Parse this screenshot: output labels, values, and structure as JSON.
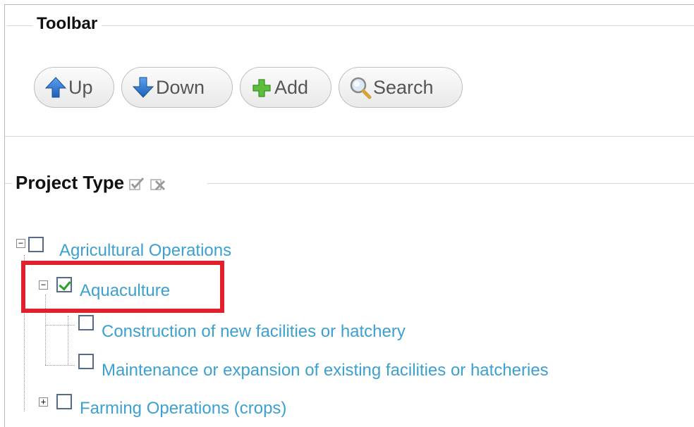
{
  "toolbar": {
    "title": "Toolbar",
    "buttons": [
      {
        "label": "Up",
        "icon": "arrow-up-icon"
      },
      {
        "label": "Down",
        "icon": "arrow-down-icon"
      },
      {
        "label": "Add",
        "icon": "plus-icon"
      },
      {
        "label": "Search",
        "icon": "magnifier-icon"
      }
    ]
  },
  "project_type": {
    "title": "Project Type",
    "tree": [
      {
        "label": "Agricultural Operations",
        "checked": false,
        "expanded": true
      },
      {
        "label": "Aquaculture",
        "checked": true,
        "expanded": true,
        "highlighted": true
      },
      {
        "label": "Construction of new facilities or hatchery",
        "checked": false
      },
      {
        "label": "Maintenance or expansion of existing facilities or hatcheries",
        "checked": false
      },
      {
        "label": "Farming Operations (crops)",
        "checked": false,
        "expanded": false
      }
    ]
  },
  "colors": {
    "link": "#3ca0d0",
    "highlight": "#e0202a",
    "check": "#2aa12a",
    "up_down_icon": "#2a6fc9",
    "add_icon": "#4caf3a"
  }
}
